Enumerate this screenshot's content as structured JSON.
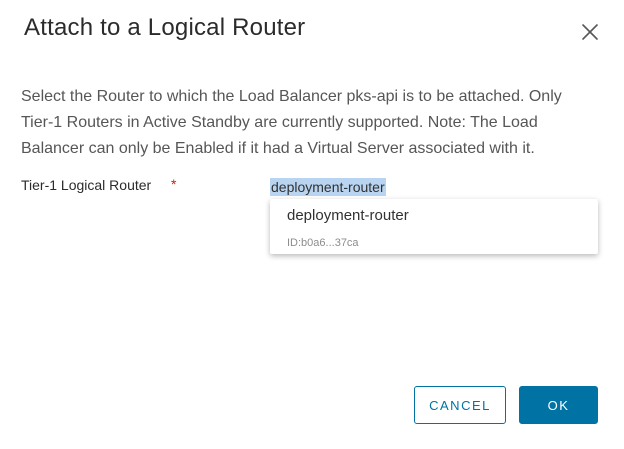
{
  "dialog": {
    "title": "Attach to a Logical Router",
    "description": "Select the Router to which the Load Balancer pks-api is to be attached. Only Tier-1 Routers in Active Standby are currently supported. Note: The Load Balancer can only be Enabled if it had a Virtual Server associated with it.",
    "close_icon": "close-icon"
  },
  "form": {
    "router_label": "Tier-1 Logical Router",
    "required_mark": "*",
    "router_value": "deployment-router"
  },
  "dropdown": {
    "options": [
      {
        "name": "deployment-router",
        "id": "ID:b0a6...37ca"
      }
    ]
  },
  "buttons": {
    "cancel_label": "CANCEL",
    "ok_label": "OK"
  },
  "colors": {
    "primary": "#0072a3",
    "required": "#c92100",
    "selection_highlight": "#b8d4f0"
  }
}
